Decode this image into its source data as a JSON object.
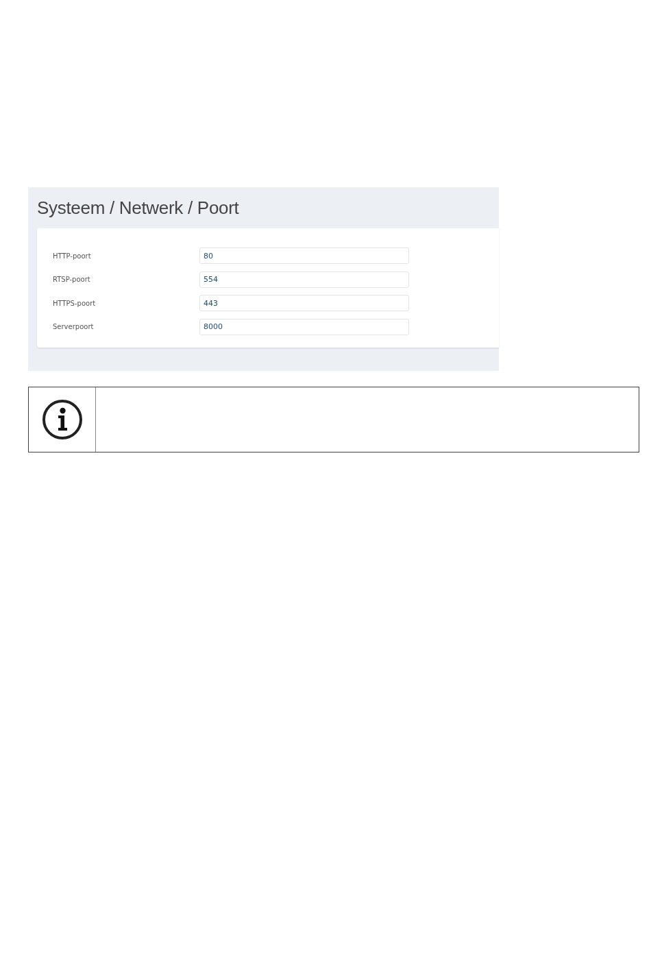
{
  "screenshot": {
    "title": "Systeem / Netwerk / Poort",
    "fields": [
      {
        "label": "HTTP-poort",
        "value": "80"
      },
      {
        "label": "RTSP-poort",
        "value": "554"
      },
      {
        "label": "HTTPS-poort",
        "value": "443"
      },
      {
        "label": "Serverpoort",
        "value": "8000"
      }
    ]
  },
  "note": {
    "kind": "info"
  }
}
